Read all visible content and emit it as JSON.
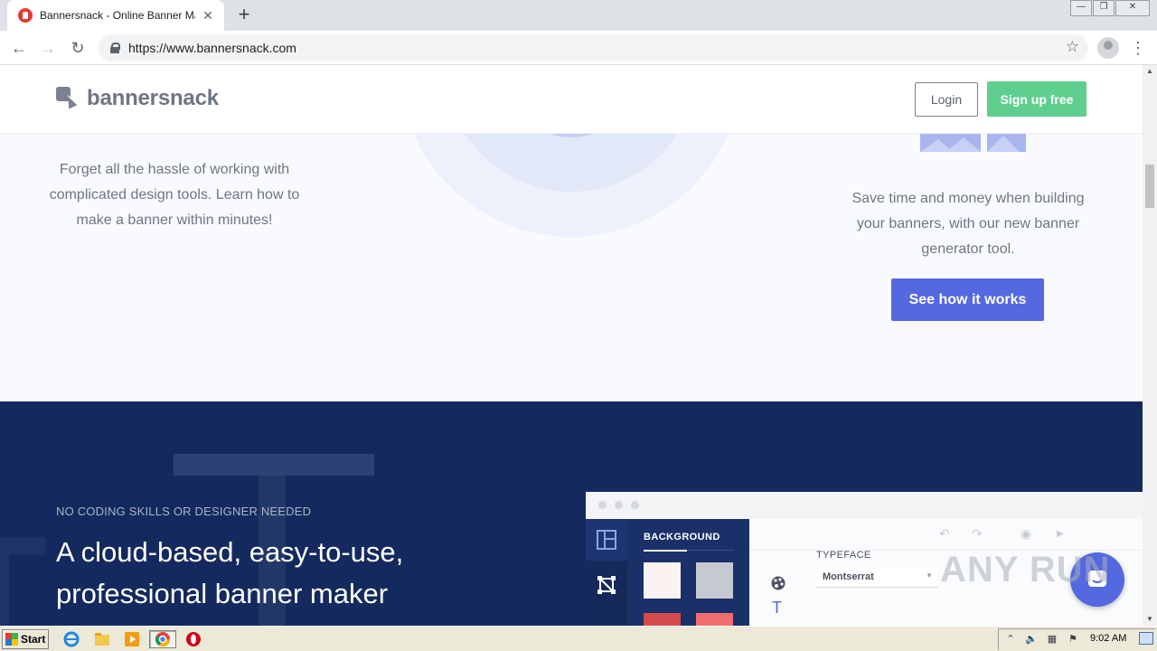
{
  "browser": {
    "tab_title": "Bannersnack - Online Banner Maker, ",
    "url": "https://www.bannersnack.com",
    "minimize_glyph": "—",
    "restore_glyph": "❐",
    "close_glyph": "✕",
    "tab_close_glyph": "✕",
    "new_tab_glyph": "+",
    "back_glyph": "←",
    "forward_glyph": "→",
    "reload_glyph": "↻",
    "star_glyph": "☆",
    "menu_glyph": "⋮"
  },
  "site": {
    "logo_text": "bannersnack",
    "login_label": "Login",
    "signup_label": "Sign up free"
  },
  "features": {
    "left_text": "Forget all the hassle of working with complicated design tools. Learn how to make a banner within minutes!",
    "right_text": "Save time and money when building your banners, with our new banner generator tool.",
    "cta_label": "See how it works"
  },
  "promo": {
    "eyebrow": "NO CODING SKILLS OR DESIGNER NEEDED",
    "headline": "A cloud-based, easy-to-use, professional banner maker"
  },
  "editor": {
    "panel_title": "BACKGROUND",
    "typeface_label": "TYPEFACE",
    "typeface_value": "Montserrat",
    "swatch_colors": [
      "#fbf2f2",
      "#c6c9d1",
      "#d24b4b",
      "#f26d6d"
    ]
  },
  "watermark": "ANY  RUN",
  "colors": {
    "brand_green": "#5fcf8e",
    "brand_blue": "#5468e0",
    "navy": "#142a5e"
  },
  "taskbar": {
    "start_label": "Start",
    "time": "9:02 AM",
    "apps": [
      "ie-icon",
      "explorer-icon",
      "media-player-icon",
      "chrome-icon",
      "opera-icon"
    ]
  }
}
